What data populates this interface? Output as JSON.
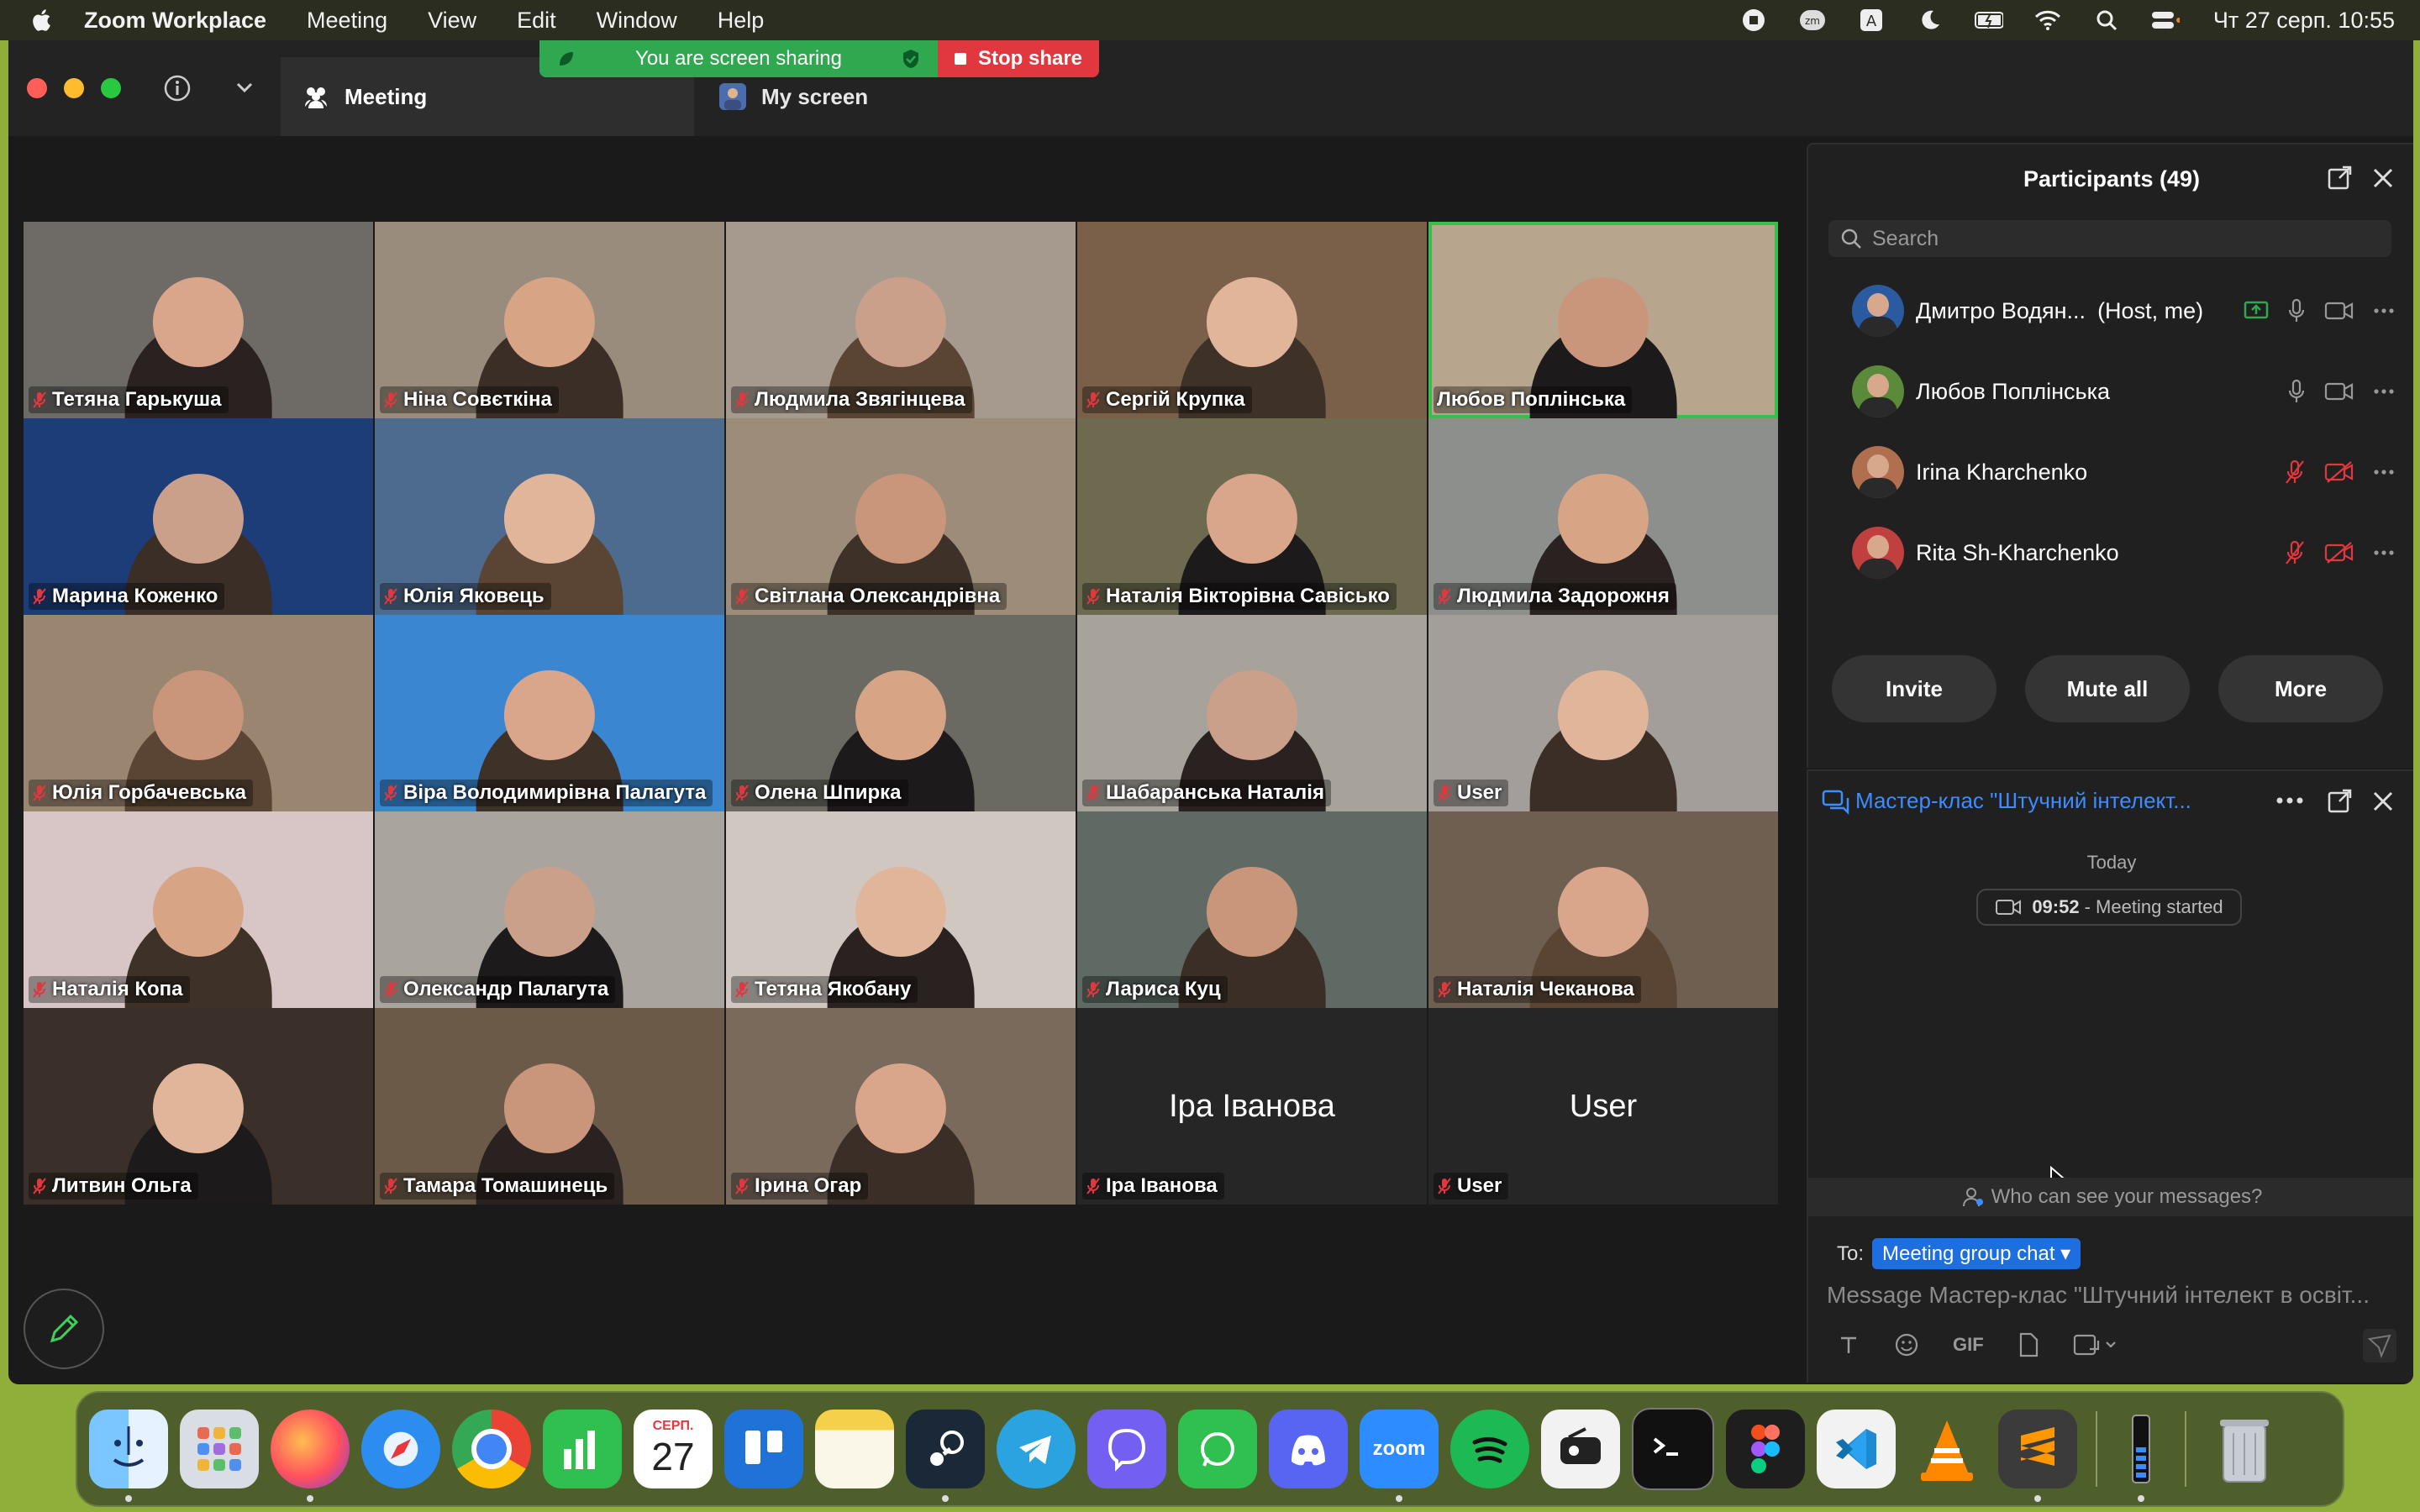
{
  "menubar": {
    "app": "Zoom Workplace",
    "items": [
      "Meeting",
      "View",
      "Edit",
      "Window",
      "Help"
    ],
    "clock": "Чт 27 серп.  10:55"
  },
  "tabs": {
    "meeting": "Meeting",
    "screen": "My screen"
  },
  "share_banner": {
    "status": "You are screen sharing",
    "stop": "Stop share"
  },
  "grid": [
    [
      "Тетяна Гарькуша",
      "Ніна Совєткіна",
      "Людмила Звягінцева",
      "Сергій Крупка",
      "Любов Поплінська"
    ],
    [
      "Марина Коженко",
      "Юлія Яковець",
      "Світлана Олександрівна",
      "Наталія Вікторівна Савісько",
      "Людмила Задорожня"
    ],
    [
      "Юлія Горбачевська",
      "Віра Володимирівна Палагута",
      "Олена Шпирка",
      "Шабаранська Наталія",
      "User"
    ],
    [
      "Наталія Копа",
      "Олександр Палагута",
      "Тетяна Якобану",
      "Лариса Куц",
      "Наталія Чеканова"
    ],
    [
      "Литвин Ольга",
      "Тамара Томашинець",
      "Ірина Огар",
      "Іра Іванова",
      "User"
    ]
  ],
  "grid_no_video": {
    "tile_3_4": "Іра Іванова",
    "tile_4_4": "User"
  },
  "participants": {
    "title": "Participants (49)",
    "search_placeholder": "Search",
    "list": [
      {
        "name": "Дмитро Водян...",
        "tag": "(Host, me)"
      },
      {
        "name": "Любов Поплінська",
        "tag": ""
      },
      {
        "name": "Irina Kharchenko",
        "tag": ""
      },
      {
        "name": "Rita Sh-Kharchenko",
        "tag": ""
      }
    ],
    "buttons": {
      "invite": "Invite",
      "mute_all": "Mute all",
      "more": "More"
    }
  },
  "chat": {
    "title": "Мастер-клас \"Штучний інтелект...",
    "today": "Today",
    "started_time": "09:52",
    "started_text": "- Meeting started",
    "who_can_see": "Who can see your messages?",
    "to_label": "To:",
    "to_value": "Meeting group chat",
    "placeholder": "Message Мастер-клас \"Штучний інтелект в освіт...",
    "gif": "GIF"
  },
  "dock": {
    "calendar_month": "СЕРП.",
    "calendar_day": "27",
    "zoom_label": "zoom"
  },
  "colors": {
    "accent_green": "#2fa84f",
    "stop_red": "#e0383e",
    "link_blue": "#3d8dff",
    "muted_red": "#e0383e"
  }
}
